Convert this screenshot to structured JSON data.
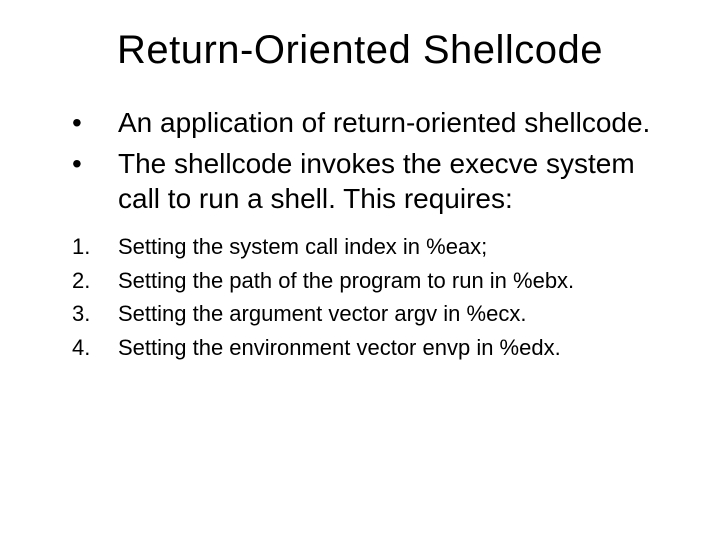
{
  "title": "Return-Oriented Shellcode",
  "bullets": [
    {
      "marker": "•",
      "text": "An application of return-oriented shellcode."
    },
    {
      "marker": "•",
      "text": "The shellcode invokes the execve system call to run a shell. This requires:"
    }
  ],
  "numbered": [
    {
      "marker": "1.",
      "text": "Setting the system call index in %eax;"
    },
    {
      "marker": "2.",
      "text": "Setting the path of the program to run in %ebx."
    },
    {
      "marker": "3.",
      "text": "Setting the argument vector argv in %ecx."
    },
    {
      "marker": "4.",
      "text": "Setting the environment vector envp in %edx."
    }
  ]
}
